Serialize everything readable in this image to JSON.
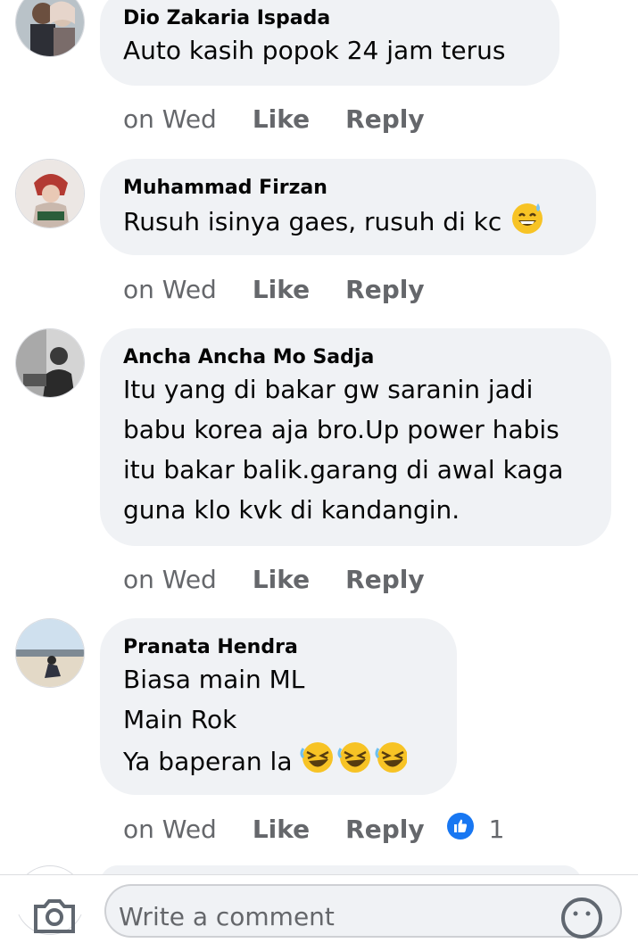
{
  "comments": [
    {
      "author": "Dio Zakaria Ispada",
      "text": "Auto kasih popok 24 jam terus",
      "time": "on Wed",
      "like": "Like",
      "reply": "Reply"
    },
    {
      "author": "Muhammad Firzan",
      "text": "Rusuh isinya gaes, rusuh di kc",
      "time": "on Wed",
      "like": "Like",
      "reply": "Reply",
      "emoji": "grinning-sweat"
    },
    {
      "author": "Ancha Ancha Mo Sadja",
      "text": "Itu yang di bakar gw saranin jadi\nbabu korea aja bro.Up power habis\nitu bakar balik.garang di awal kaga\nguna klo kvk di kandangin.",
      "time": "on Wed",
      "like": "Like",
      "reply": "Reply"
    },
    {
      "author": "Pranata Hendra",
      "text": "Biasa main ML\nMain Rok\nYa baperan la",
      "time": "on Wed",
      "like": "Like",
      "reply": "Reply",
      "emoji": "rolling-laughing",
      "reaction_count": "1"
    }
  ],
  "composer": {
    "placeholder": "Write a comment"
  },
  "colors": {
    "bubble": "#f0f2f5",
    "text": "#050505",
    "muted": "#65676b",
    "like_blue": "#1877f2"
  }
}
